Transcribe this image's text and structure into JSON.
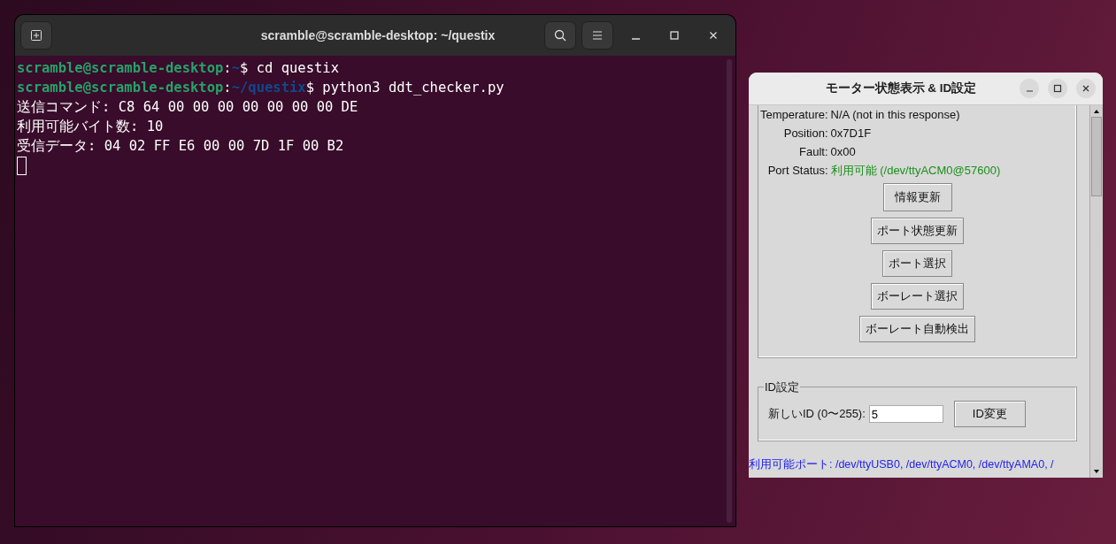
{
  "terminal": {
    "title": "scramble@scramble-desktop: ~/questix",
    "lines": [
      {
        "kind": "prompt",
        "user": "scramble@scramble-desktop",
        "separator": ":",
        "path": "~",
        "symbol": "$",
        "command": "cd questix"
      },
      {
        "kind": "prompt",
        "user": "scramble@scramble-desktop",
        "separator": ":",
        "path": "~/questix",
        "symbol": "$",
        "command": "python3 ddt_checker.py"
      },
      {
        "kind": "output",
        "text": "送信コマンド: C8 64 00 00 00 00 00 00 00 DE"
      },
      {
        "kind": "output",
        "text": "利用可能バイト数: 10"
      },
      {
        "kind": "output",
        "text": "受信データ: 04 02 FF E6 00 00 7D 1F 00 B2"
      }
    ]
  },
  "dialog": {
    "title": "モーター状態表示 & ID設定",
    "info_rows": [
      {
        "label": "Temperature:",
        "value": "N/A (not in this response)",
        "kind": "plain"
      },
      {
        "label": "Position:",
        "value": "0x7D1F",
        "kind": "plain"
      },
      {
        "label": "Fault:",
        "value": "0x00",
        "kind": "plain"
      },
      {
        "label": "Port Status:",
        "value": "利用可能 (/dev/ttyACM0@57600)",
        "kind": "status"
      }
    ],
    "buttons": [
      "情報更新",
      "ポート状態更新",
      "ポート選択",
      "ボーレート選択",
      "ボーレート自動検出"
    ],
    "id_group": {
      "title": "ID設定",
      "label": "新しいID (0〜255):",
      "value": "5",
      "button": "ID変更"
    },
    "footer": "利用可能ポート: /dev/ttyUSB0, /dev/ttyACM0, /dev/ttyAMA0, /"
  }
}
